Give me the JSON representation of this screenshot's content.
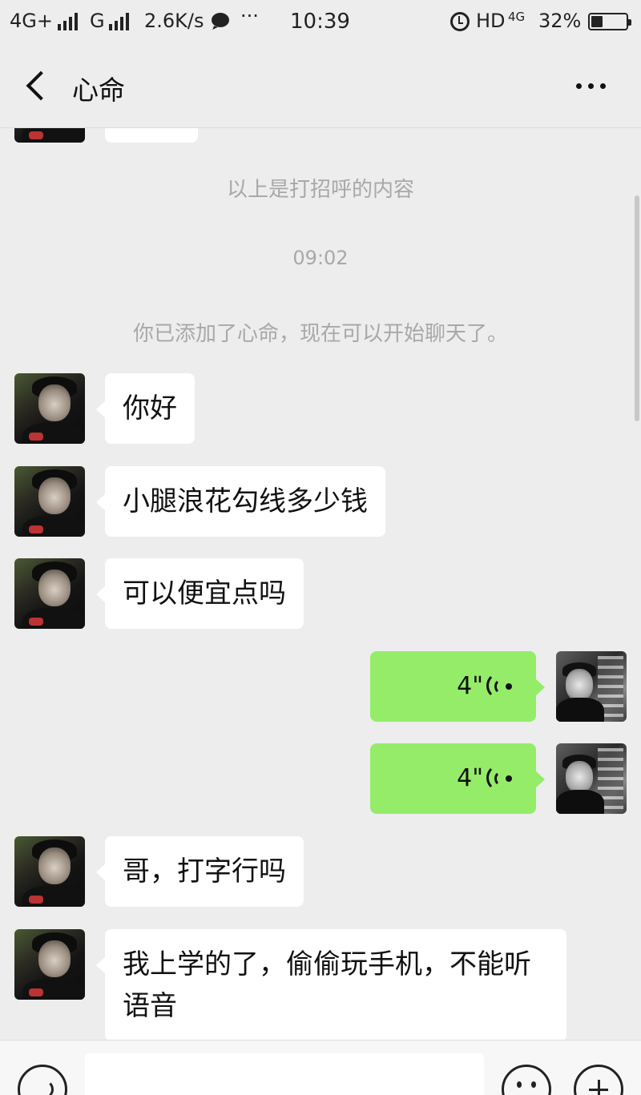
{
  "status_bar": {
    "network1": "4G+",
    "network2": "G",
    "speed": "2.6K/s",
    "more": "···",
    "time": "10:39",
    "hd": "HD",
    "network3": "4G",
    "battery": "32%"
  },
  "nav": {
    "title": "心命"
  },
  "chat": {
    "greeting_note": "以上是打招呼的内容",
    "timestamp": "09:02",
    "added_note": "你已添加了心命，现在可以开始聊天了。",
    "messages": [
      {
        "from": "them",
        "type": "text",
        "text": "你好"
      },
      {
        "from": "them",
        "type": "text",
        "text": "小腿浪花勾线多少钱"
      },
      {
        "from": "them",
        "type": "text",
        "text": "可以便宜点吗"
      },
      {
        "from": "me",
        "type": "voice",
        "duration": "4\""
      },
      {
        "from": "me",
        "type": "voice",
        "duration": "4\""
      },
      {
        "from": "them",
        "type": "text",
        "text": "哥，打字行吗"
      },
      {
        "from": "them",
        "type": "text",
        "text": "我上学的了，偷偷玩手机，不能听语音"
      }
    ]
  },
  "colors": {
    "background": "#ededed",
    "my_bubble": "#95ec69",
    "their_bubble": "#ffffff",
    "system_text": "#a8a8a8"
  }
}
